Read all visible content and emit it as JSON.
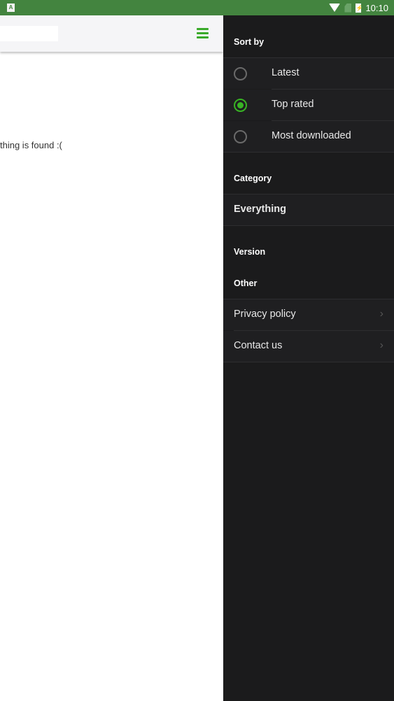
{
  "statusbar": {
    "time": "10:10",
    "notification_icon": "A",
    "icons": [
      "wifi-icon",
      "no-sim-icon",
      "battery-charging-icon"
    ]
  },
  "toolbar": {
    "search_value": "",
    "menu_icon": "hamburger-menu-icon"
  },
  "main": {
    "empty_message": "thing is found :("
  },
  "drawer": {
    "sort_by": {
      "heading": "Sort by",
      "options": [
        {
          "label": "Latest",
          "selected": false
        },
        {
          "label": "Top rated",
          "selected": true
        },
        {
          "label": "Most downloaded",
          "selected": false
        }
      ]
    },
    "category": {
      "heading": "Category",
      "value": "Everything"
    },
    "version": {
      "heading": "Version"
    },
    "other": {
      "heading": "Other",
      "items": [
        {
          "label": "Privacy policy",
          "icon": "chevron-right-icon"
        },
        {
          "label": "Contact us",
          "icon": "chevron-right-icon"
        }
      ]
    }
  },
  "colors": {
    "statusbar": "#43843f",
    "accent": "#38b324",
    "drawer_bg": "#1b1b1c"
  }
}
